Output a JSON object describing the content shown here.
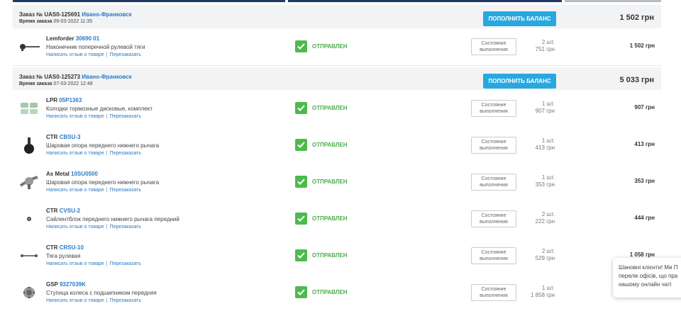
{
  "colors": {
    "accent": "#29a8e0",
    "link": "#2a7ac6",
    "status_green": "#4cbb4c",
    "header_bg": "#f2f3f5"
  },
  "orders": [
    {
      "number_label": "Заказ № UAS0-125691",
      "city": "Ивано-Франковск",
      "time_label": "Время заказа",
      "time_value": "09-03-2022 11:35",
      "topup_label": "ПОПОЛНИТЬ БАЛАНС",
      "total": "1 502 грн",
      "items": [
        {
          "icon": "tie-rod-end-icon",
          "brand": "Lemforder",
          "code": "30690 01",
          "desc": "Наконечник поперечной рулевой тяги",
          "review": "Написать отзыв о товаре",
          "reorder": "Перезаказать",
          "status": "ОТПРАВЛЕН",
          "state_btn_1": "Состояние",
          "state_btn_2": "выполнения",
          "qty": "2 шт.",
          "unit_price": "751 грн",
          "price": "1 502 грн"
        }
      ]
    },
    {
      "number_label": "Заказ № UAS0-125273",
      "city": "Ивано-Франковск",
      "time_label": "Время заказа",
      "time_value": "07-03-2022 12:48",
      "topup_label": "ПОПОЛНИТЬ БАЛАНС",
      "total": "5 033 грн",
      "items": [
        {
          "icon": "brake-pads-icon",
          "brand": "LPR",
          "code": "05P1363",
          "desc": "Колодки тормозные дисковые, комплект",
          "review": "Написать отзыв о товаре",
          "reorder": "Перезаказать",
          "status": "ОТПРАВЛЕН",
          "state_btn_1": "Состояние",
          "state_btn_2": "выполнения",
          "qty": "1 шт.",
          "unit_price": "907 грн",
          "price": "907 грн"
        },
        {
          "icon": "ball-joint-icon",
          "brand": "CTR",
          "code": "CBSU-3",
          "desc": "Шаровая опора переднего нижнего рычага",
          "review": "Написать отзыв о товаре",
          "reorder": "Перезаказать",
          "status": "ОТПРАВЛЕН",
          "state_btn_1": "Состояние",
          "state_btn_2": "выполнения",
          "qty": "1 шт.",
          "unit_price": "413 грн",
          "price": "413 грн"
        },
        {
          "icon": "ball-joint-icon",
          "brand": "As Metal",
          "code": "10SU0500",
          "desc": "Шаровая опора переднего нижнего рычага",
          "review": "Написать отзыв о товаре",
          "reorder": "Перезаказать",
          "status": "ОТПРАВЛЕН",
          "state_btn_1": "Состояние",
          "state_btn_2": "выполнения",
          "qty": "1 шт.",
          "unit_price": "353 грн",
          "price": "353 грн"
        },
        {
          "icon": "silent-block-icon",
          "brand": "CTR",
          "code": "CVSU-2",
          "desc": "Сайлентблок переднего нижнего рычага передний",
          "review": "Написать отзыв о товаре",
          "reorder": "Перезаказать",
          "status": "ОТПРАВЛЕН",
          "state_btn_1": "Состояние",
          "state_btn_2": "выполнения",
          "qty": "2 шт.",
          "unit_price": "222 грн",
          "price": "444 грн"
        },
        {
          "icon": "tie-rod-icon",
          "brand": "CTR",
          "code": "CRSU-10",
          "desc": "Тяга рулевая",
          "review": "Написать отзыв о товаре",
          "reorder": "Перезаказать",
          "status": "ОТПРАВЛЕН",
          "state_btn_1": "Состояние",
          "state_btn_2": "выполнения",
          "qty": "2 шт.",
          "unit_price": "529 грн",
          "price": "1 058 грн"
        },
        {
          "icon": "wheel-hub-icon",
          "brand": "GSP",
          "code": "9327039K",
          "desc": "Ступица колеса с подшипником передняя",
          "review": "Написать отзыв о товаре",
          "reorder": "Перезаказать",
          "status": "ОТПРАВЛЕН",
          "state_btn_1": "Состояние",
          "state_btn_2": "выполнения",
          "qty": "1 шт.",
          "unit_price": "1 858 грн",
          "price": ""
        }
      ]
    }
  ],
  "chat_popup": {
    "line1": "Шановні клієнти! Ми П",
    "line2": "перелік офісів, що пра",
    "line3": "нашому онлайн чаті"
  }
}
